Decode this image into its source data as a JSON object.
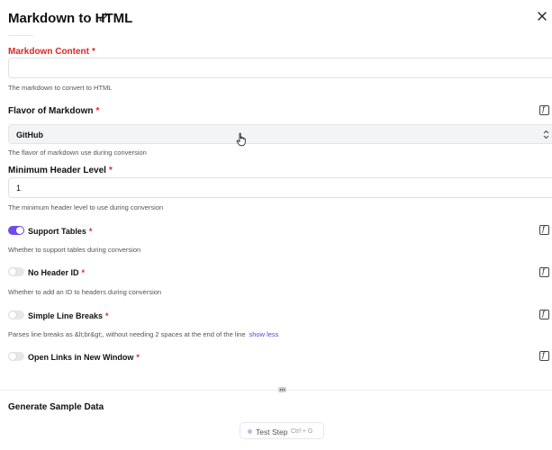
{
  "header": {
    "title": "Markdown to HTML",
    "edit_icon": "pencil-icon",
    "close_icon": "close-icon"
  },
  "fields": {
    "markdown_content": {
      "label": "Markdown Content",
      "required_mark": "*",
      "value": "",
      "help": "The markdown to convert to HTML"
    },
    "flavor": {
      "label": "Flavor of Markdown",
      "required_mark": "*",
      "value": "GitHub",
      "help": "The flavor of markdown use during conversion"
    },
    "min_header_level": {
      "label": "Minimum Header Level",
      "required_mark": "*",
      "value": "1",
      "help": "The minimum header level to use during conversion"
    },
    "support_tables": {
      "label": "Support Tables",
      "required_mark": "*",
      "checked": true,
      "help": "Whether to support tables during conversion"
    },
    "no_header_id": {
      "label": "No Header ID",
      "required_mark": "*",
      "checked": false,
      "help": "Whether to add an ID to headers during conversion"
    },
    "simple_line_breaks": {
      "label": "Simple Line Breaks",
      "required_mark": "*",
      "checked": false,
      "help": "Parses line breaks as &lt;br&gt;, without needing 2 spaces at the end of the line",
      "show_less": "show less"
    },
    "open_links": {
      "label": "Open Links in New Window",
      "required_mark": "*",
      "checked": false
    }
  },
  "footer": {
    "title": "Generate Sample Data",
    "test_button": "Test Step",
    "shortcut": "Ctrl + G"
  },
  "colors": {
    "accent": "#6d4ee8",
    "required": "#dc2626"
  }
}
